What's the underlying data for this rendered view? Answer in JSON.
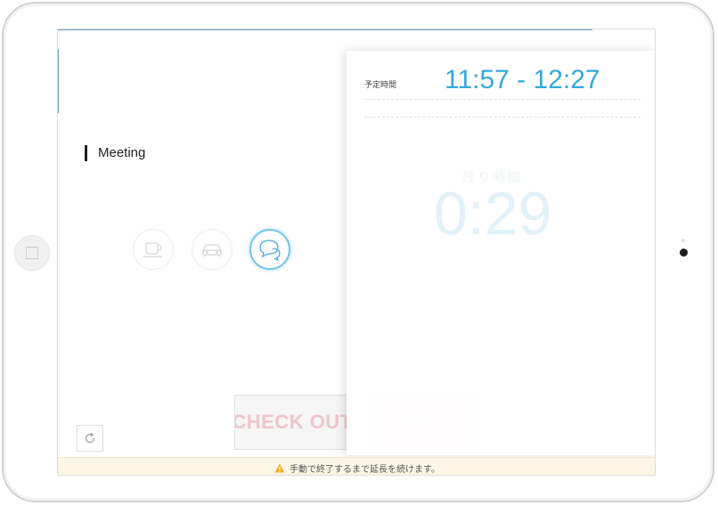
{
  "device": {
    "frame": "tablet"
  },
  "room": {
    "category_label": "Meeting"
  },
  "categories": [
    {
      "name": "coffee",
      "icon": "coffee-cup-icon",
      "selected": false
    },
    {
      "name": "car",
      "icon": "car-icon",
      "selected": false
    },
    {
      "name": "meeting",
      "icon": "chat-bubbles-icon",
      "selected": true
    }
  ],
  "schedule": {
    "label": "予定時間",
    "time_range": "11:57 - 12:27"
  },
  "remaining": {
    "label": "残り時間",
    "time": "0:29"
  },
  "actions": {
    "checkout_label": "CHECK OUT",
    "extend_icon": "arrow-left-icon"
  },
  "footer": {
    "notice": "手動で終了するまで延長を続けます。",
    "notice_icon": "warning-icon"
  },
  "colors": {
    "accent": "#35a8d8",
    "selected_ring": "#78c5ea",
    "checkout_text": "#efc5cc",
    "extend_bg": "#fbe5e8",
    "notice_bg": "#fdf6e7"
  }
}
